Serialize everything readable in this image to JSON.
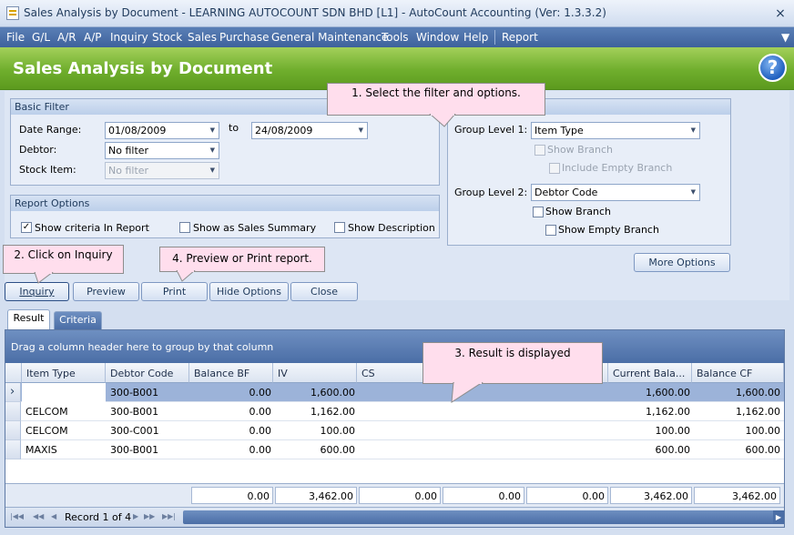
{
  "window": {
    "title": "Sales Analysis by Document - LEARNING AUTOCOUNT SDN BHD [L1] - AutoCount Accounting (Ver: 1.3.3.2)",
    "close": "×"
  },
  "menu": [
    "File",
    "G/L",
    "A/R",
    "A/P",
    "Inquiry",
    "Stock",
    "Sales",
    "Purchase",
    "General Maintenance",
    "Tools",
    "Window",
    "Help",
    "Report"
  ],
  "header": {
    "title": "Sales Analysis by Document",
    "help": "?"
  },
  "basic_filter": {
    "title": "Basic Filter",
    "date_range_label": "Date Range:",
    "date_from": "01/08/2009",
    "to_label": "to",
    "date_to": "24/08/2009",
    "debtor_label": "Debtor:",
    "debtor_value": "No filter",
    "stock_item_label": "Stock Item:",
    "stock_item_value": "No filter"
  },
  "report_options": {
    "title": "Report Options",
    "show_criteria": "Show criteria In Report",
    "show_sales_summary": "Show as Sales Summary",
    "show_description": "Show Description"
  },
  "grouping": {
    "group1_label": "Group Level 1:",
    "group1_value": "Item Type",
    "show_branch_1": "Show Branch",
    "include_empty_branch": "Include Empty Branch",
    "group2_label": "Group Level 2:",
    "group2_value": "Debtor Code",
    "show_branch_2": "Show Branch",
    "show_empty_branch": "Show Empty Branch"
  },
  "buttons": {
    "more_options": "More Options",
    "inquiry": "Inquiry",
    "preview": "Preview",
    "print": "Print",
    "hide_options": "Hide Options",
    "close": "Close"
  },
  "callouts": {
    "c1": "1. Select the filter and options.",
    "c2": "2. Click on Inquiry",
    "c3": "3. Result is displayed",
    "c4": "4. Preview or Print report."
  },
  "tabs": {
    "result": "Result",
    "criteria": "Criteria"
  },
  "grid": {
    "group_hint": "Drag a column header here to group by that column",
    "columns": [
      "Item Type",
      "Debtor Code",
      "Balance BF",
      "IV",
      "CS",
      "Current Bala...",
      "Balance CF"
    ],
    "rows": [
      {
        "item_type": "",
        "debtor": "300-B001",
        "bal_bf": "0.00",
        "iv": "1,600.00",
        "cur": "1,600.00",
        "bal_cf": "1,600.00"
      },
      {
        "item_type": "CELCOM",
        "debtor": "300-B001",
        "bal_bf": "0.00",
        "iv": "1,162.00",
        "cur": "1,162.00",
        "bal_cf": "1,162.00"
      },
      {
        "item_type": "CELCOM",
        "debtor": "300-C001",
        "bal_bf": "0.00",
        "iv": "100.00",
        "cur": "100.00",
        "bal_cf": "100.00"
      },
      {
        "item_type": "MAXIS",
        "debtor": "300-B001",
        "bal_bf": "0.00",
        "iv": "600.00",
        "cur": "600.00",
        "bal_cf": "600.00"
      }
    ],
    "totals": [
      "0.00",
      "3,462.00",
      "0.00",
      "0.00",
      "0.00",
      "3,462.00",
      "3,462.00"
    ],
    "record_label": "Record 1 of 4",
    "row_indicator": "›"
  },
  "colors": {
    "menu_bg": "#3e629c",
    "header_green": "#6fae2d",
    "callout_pink": "#ffdeed",
    "selected_row": "#9cb3d9"
  }
}
